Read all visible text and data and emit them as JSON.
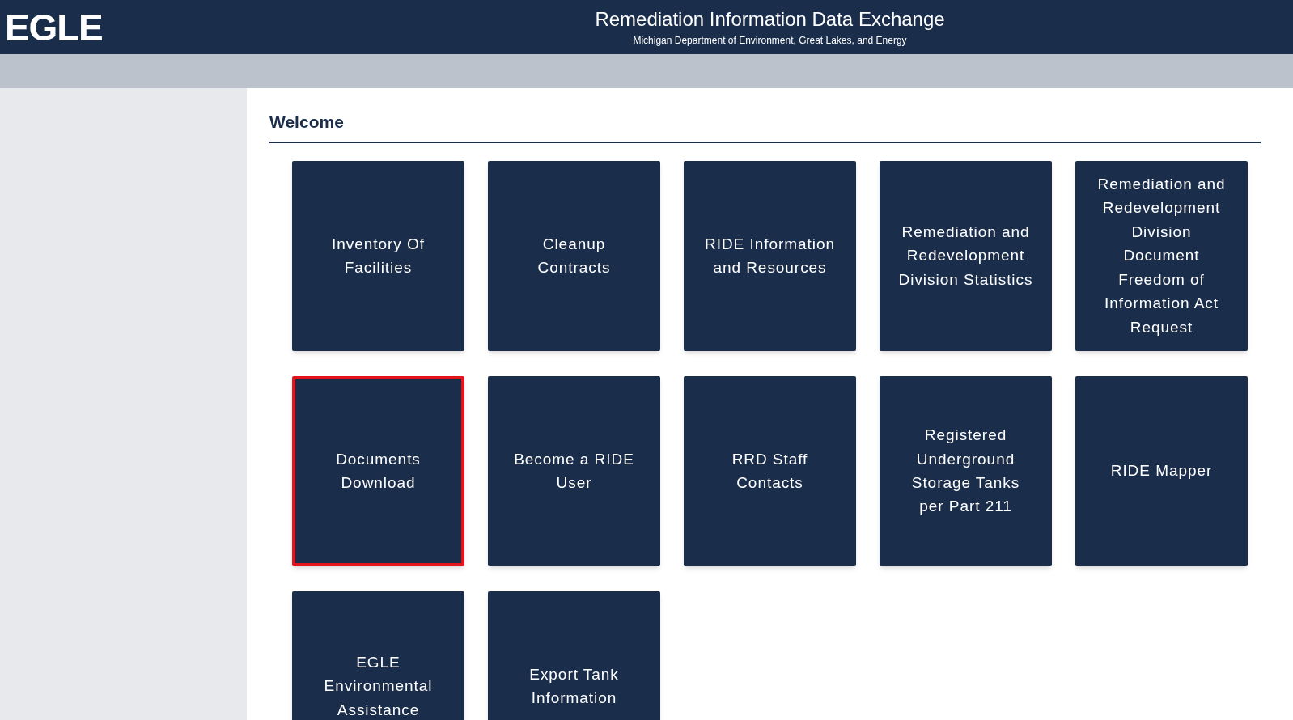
{
  "header": {
    "logo": "EGLE",
    "title": "Remediation Information Data Exchange",
    "subtitle": "Michigan Department of Environment, Great Lakes, and Energy"
  },
  "section": {
    "heading": "Welcome"
  },
  "tiles": [
    {
      "label": "Inventory Of Facilities",
      "selected": false
    },
    {
      "label": "Cleanup Contracts",
      "selected": false
    },
    {
      "label": "RIDE Information and Resources",
      "selected": false
    },
    {
      "label": "Remediation and Redevelopment Division Statistics",
      "selected": false
    },
    {
      "label": "Remediation and Redevelopment Division Document Freedom of Information Act Request",
      "selected": false
    },
    {
      "label": "Documents Download",
      "selected": true
    },
    {
      "label": "Become a RIDE User",
      "selected": false
    },
    {
      "label": "RRD Staff Contacts",
      "selected": false
    },
    {
      "label": "Registered Underground Storage Tanks per Part 211",
      "selected": false
    },
    {
      "label": "RIDE Mapper",
      "selected": false
    },
    {
      "label": "EGLE Environmental Assistance",
      "selected": false
    },
    {
      "label": "Export Tank Information",
      "selected": false
    }
  ]
}
